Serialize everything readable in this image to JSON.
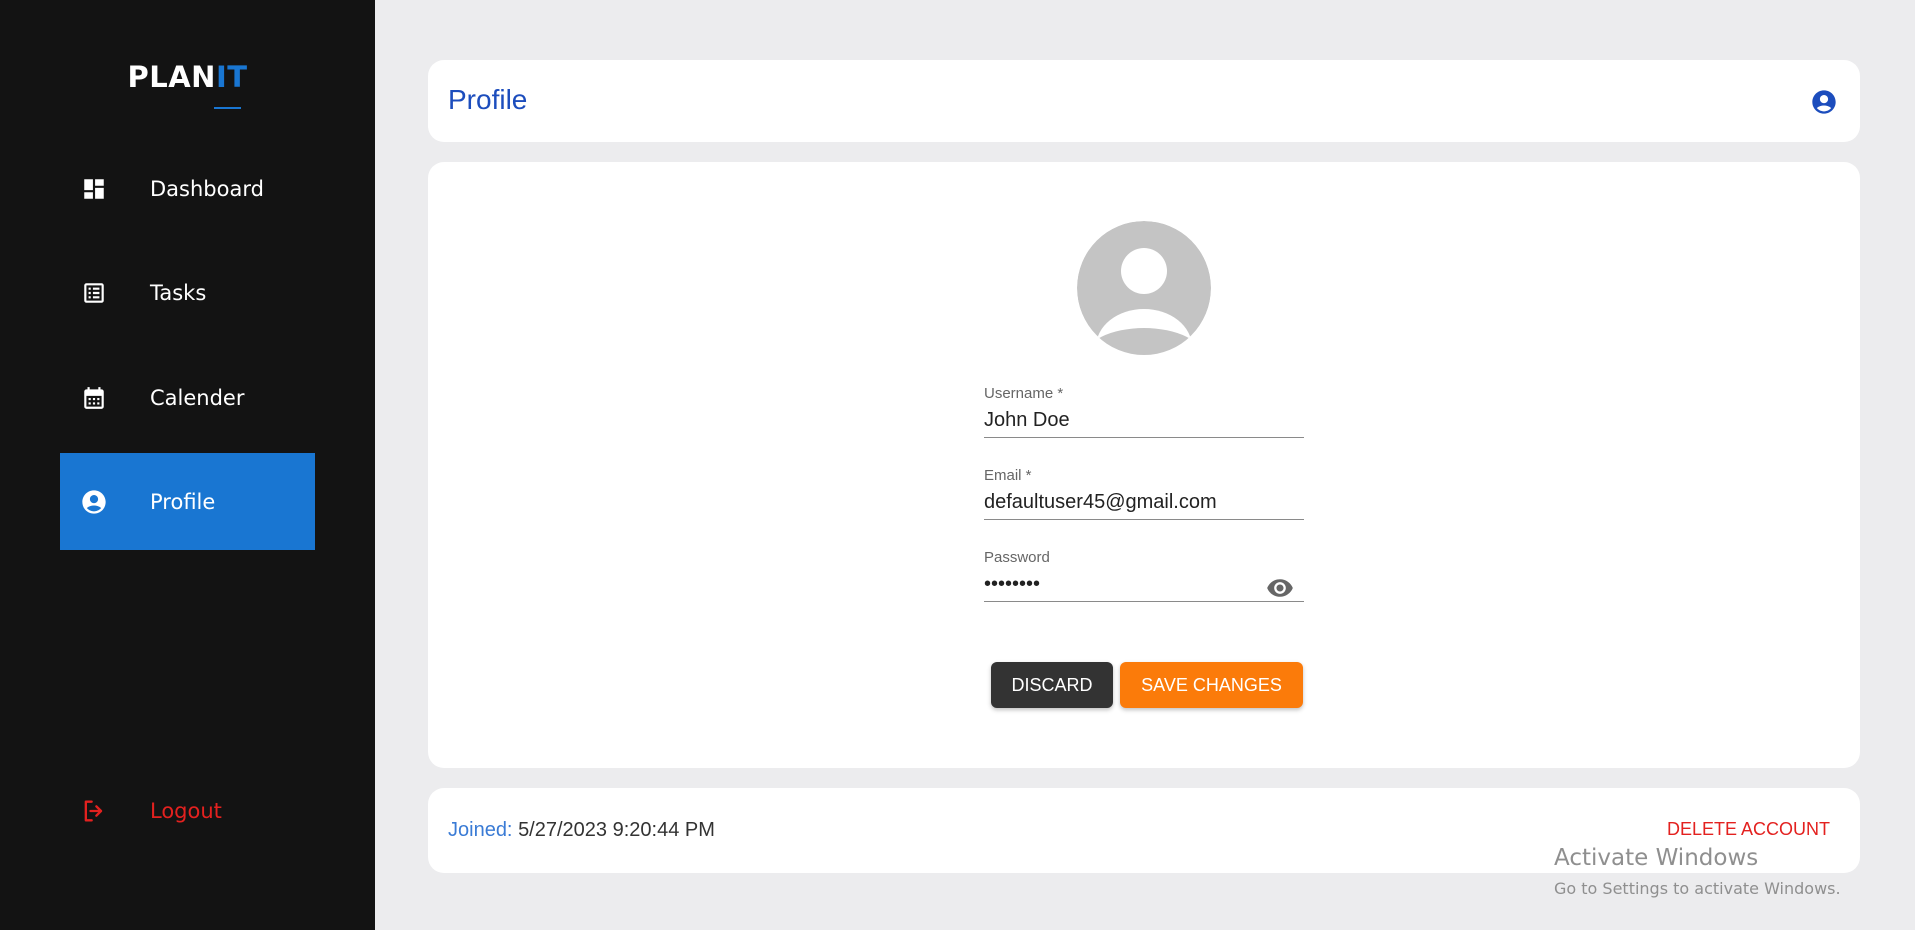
{
  "sidebar": {
    "logo_plan": "PLAN",
    "logo_it": "IT",
    "items": [
      {
        "label": "Dashboard",
        "icon": "dashboard-icon"
      },
      {
        "label": "Tasks",
        "icon": "tasks-list-icon"
      },
      {
        "label": "Calender",
        "icon": "calendar-icon"
      },
      {
        "label": "Profile",
        "icon": "profile-icon",
        "active": true
      }
    ],
    "logout_label": "Logout"
  },
  "header": {
    "title": "Profile",
    "avatar_icon": "account-circle-icon"
  },
  "form": {
    "avatar_icon": "default-avatar-icon",
    "username": {
      "label": "Username *",
      "value": "John Doe"
    },
    "email": {
      "label": "Email *",
      "value": "defaultuser45@gmail.com"
    },
    "password": {
      "label": "Password",
      "value": "••••••••",
      "toggle_icon": "eye-icon"
    },
    "discard_label": "DISCARD",
    "save_label": "SAVE CHANGES"
  },
  "footer": {
    "joined_label": "Joined:",
    "joined_value": "5/27/2023 9:20:44 PM",
    "delete_label": "DELETE ACCOUNT"
  },
  "watermark": {
    "line1": "Activate Windows",
    "line2": "Go to Settings to activate Windows."
  },
  "colors": {
    "accent": "#1976d2",
    "title_blue": "#1c4dbd",
    "save_orange": "#fb7b0a",
    "danger_red": "#e3211f",
    "sidebar_bg": "#131313"
  }
}
